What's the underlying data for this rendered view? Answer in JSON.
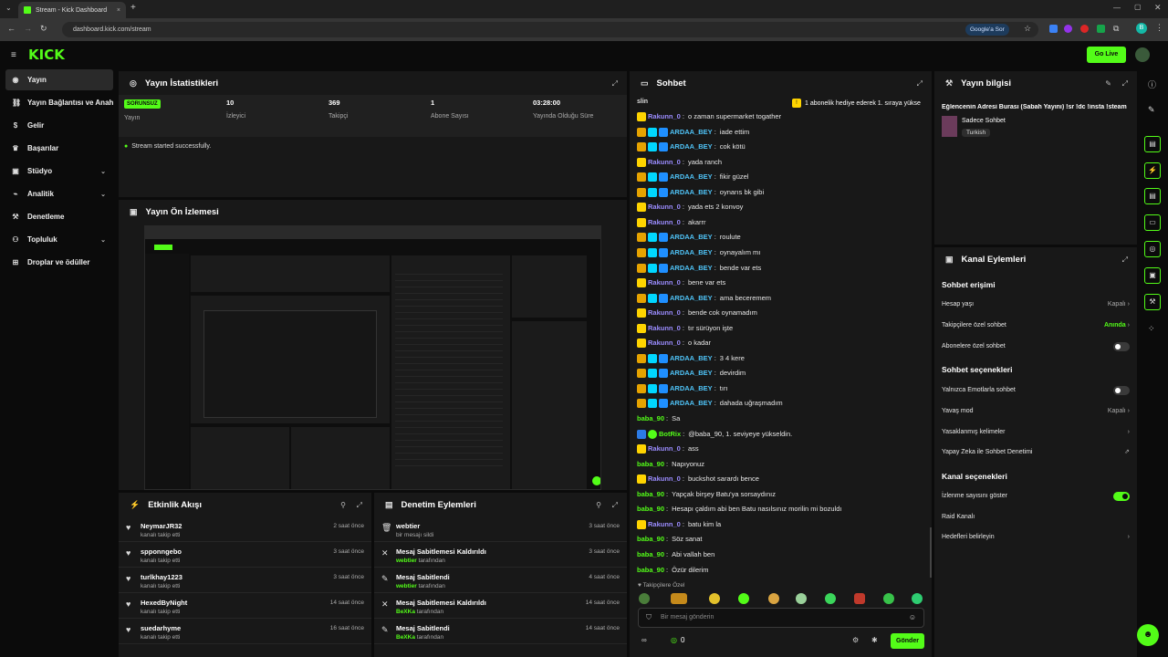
{
  "browser": {
    "tab_title": "Stream - Kick Dashboard",
    "url": "dashboard.kick.com/stream",
    "google_btn": "Google'a Sor"
  },
  "app": {
    "logo": "KICK",
    "go_live": "Go Live"
  },
  "sidebar": {
    "items": [
      {
        "label": "Yayın",
        "icon": "broadcast-icon"
      },
      {
        "label": "Yayın Bağlantısı ve Anahtar",
        "icon": "link-icon"
      },
      {
        "label": "Gelir",
        "icon": "money-icon"
      },
      {
        "label": "Başarılar",
        "icon": "trophy-icon"
      },
      {
        "label": "Stüdyo",
        "icon": "studio-icon"
      },
      {
        "label": "Analitik",
        "icon": "chart-icon"
      },
      {
        "label": "Denetleme",
        "icon": "wrench-icon"
      },
      {
        "label": "Topluluk",
        "icon": "community-icon"
      },
      {
        "label": "Droplar ve ödüller",
        "icon": "gift-icon"
      }
    ]
  },
  "stats": {
    "title": "Yayın İstatistikleri",
    "status_badge": "SORUNSUZ",
    "status_label": "Yayın",
    "viewers_value": "10",
    "viewers_label": "İzleyici",
    "followers_value": "369",
    "followers_label": "Takipçi",
    "subs_value": "1",
    "subs_label": "Abone Sayısı",
    "uptime_value": "03:28:00",
    "uptime_label": "Yayında Olduğu Süre",
    "message": "Stream started successfully."
  },
  "preview": {
    "title": "Yayın Ön İzlemesi"
  },
  "activity": {
    "title": "Etkinlik Akışı",
    "items": [
      {
        "user": "NeymarJR32",
        "action": "kanalı takip etti",
        "time": "2 saat önce"
      },
      {
        "user": "spponngebo",
        "action": "kanalı takip etti",
        "time": "3 saat önce"
      },
      {
        "user": "turlkhay1223",
        "action": "kanalı takip etti",
        "time": "3 saat önce"
      },
      {
        "user": "HexedByNight",
        "action": "kanalı takip etti",
        "time": "14 saat önce"
      },
      {
        "user": "suedarhyme",
        "action": "kanalı takip etti",
        "time": "16 saat önce"
      }
    ]
  },
  "moderation": {
    "title": "Denetim Eylemleri",
    "items": [
      {
        "title": "webtier",
        "by": "",
        "suffix": "bir mesajı sildi",
        "time": "3 saat önce"
      },
      {
        "title": "Mesaj Sabitlemesi Kaldırıldı",
        "by": "webtier",
        "suffix": "tarafından",
        "time": "3 saat önce"
      },
      {
        "title": "Mesaj Sabitlendi",
        "by": "webtier",
        "suffix": "tarafından",
        "time": "4 saat önce"
      },
      {
        "title": "Mesaj Sabitlemesi Kaldırıldı",
        "by": "BeXKa",
        "suffix": "tarafından",
        "time": "14 saat önce"
      },
      {
        "title": "Mesaj Sabitlendi",
        "by": "BeXKa",
        "suffix": "tarafından",
        "time": "14 saat önce"
      }
    ]
  },
  "chat": {
    "title": "Sohbet",
    "pinned_left": "slin",
    "pinned_banner": "1 abonelik hediye ederek 1. sıraya yükse",
    "messages": [
      {
        "user": "Rakunn_0",
        "cls": "rak",
        "badges": [
          "vip"
        ],
        "text": "o zaman supermarket togather"
      },
      {
        "user": "ARDAA_BEY",
        "cls": "ard",
        "badges": [
          "crown",
          "sub",
          "mod"
        ],
        "text": "iade ettim"
      },
      {
        "user": "ARDAA_BEY",
        "cls": "ard",
        "badges": [
          "crown",
          "sub",
          "mod"
        ],
        "text": "cok kötü"
      },
      {
        "user": "Rakunn_0",
        "cls": "rak",
        "badges": [
          "vip"
        ],
        "text": "yada ranch"
      },
      {
        "user": "ARDAA_BEY",
        "cls": "ard",
        "badges": [
          "crown",
          "sub",
          "mod"
        ],
        "text": "fikir güzel"
      },
      {
        "user": "ARDAA_BEY",
        "cls": "ard",
        "badges": [
          "crown",
          "sub",
          "mod"
        ],
        "text": "oynarıs bk gibi"
      },
      {
        "user": "Rakunn_0",
        "cls": "rak",
        "badges": [
          "vip"
        ],
        "text": "yada ets 2 konvoy"
      },
      {
        "user": "Rakunn_0",
        "cls": "rak",
        "badges": [
          "vip"
        ],
        "text": "akarrr"
      },
      {
        "user": "ARDAA_BEY",
        "cls": "ard",
        "badges": [
          "crown",
          "sub",
          "mod"
        ],
        "text": "roulute"
      },
      {
        "user": "ARDAA_BEY",
        "cls": "ard",
        "badges": [
          "crown",
          "sub",
          "mod"
        ],
        "text": "oynayalım mı"
      },
      {
        "user": "ARDAA_BEY",
        "cls": "ard",
        "badges": [
          "crown",
          "sub",
          "mod"
        ],
        "text": "bende var ets"
      },
      {
        "user": "Rakunn_0",
        "cls": "rak",
        "badges": [
          "vip"
        ],
        "text": "bene var ets"
      },
      {
        "user": "ARDAA_BEY",
        "cls": "ard",
        "badges": [
          "crown",
          "sub",
          "mod"
        ],
        "text": "ama beceremem"
      },
      {
        "user": "Rakunn_0",
        "cls": "rak",
        "badges": [
          "vip"
        ],
        "text": "bende cok oynamadım"
      },
      {
        "user": "Rakunn_0",
        "cls": "rak",
        "badges": [
          "vip"
        ],
        "text": "tır sürüyon işte"
      },
      {
        "user": "Rakunn_0",
        "cls": "rak",
        "badges": [
          "vip"
        ],
        "text": "o kadar"
      },
      {
        "user": "ARDAA_BEY",
        "cls": "ard",
        "badges": [
          "crown",
          "sub",
          "mod"
        ],
        "text": "3 4 kere"
      },
      {
        "user": "ARDAA_BEY",
        "cls": "ard",
        "badges": [
          "crown",
          "sub",
          "mod"
        ],
        "text": "devirdim"
      },
      {
        "user": "ARDAA_BEY",
        "cls": "ard",
        "badges": [
          "crown",
          "sub",
          "mod"
        ],
        "text": "tırı"
      },
      {
        "user": "ARDAA_BEY",
        "cls": "ard",
        "badges": [
          "crown",
          "sub",
          "mod"
        ],
        "text": "dahada uğraşmadım"
      },
      {
        "user": "baba_90",
        "cls": "bab",
        "badges": [],
        "text": "Sa"
      },
      {
        "user": "BotRix",
        "cls": "bot",
        "badges": [
          "bot",
          "ver"
        ],
        "text": "@baba_90, 1. seviyeye yükseldin."
      },
      {
        "user": "Rakunn_0",
        "cls": "rak",
        "badges": [
          "vip"
        ],
        "text": "ass"
      },
      {
        "user": "baba_90",
        "cls": "bab",
        "badges": [],
        "text": "Napıyonuz"
      },
      {
        "user": "Rakunn_0",
        "cls": "rak",
        "badges": [
          "vip"
        ],
        "text": "buckshot sarardı bence"
      },
      {
        "user": "baba_90",
        "cls": "bab",
        "badges": [],
        "text": "Yapçak birşey Batu'ya sorsaydınız"
      },
      {
        "user": "baba_90",
        "cls": "bab",
        "badges": [],
        "text": "Hesapı çaldım abi ben Batu nasılsınız morilin mi bozuldı"
      },
      {
        "user": "Rakunn_0",
        "cls": "rak",
        "badges": [
          "vip"
        ],
        "text": "batu kim la"
      },
      {
        "user": "baba_90",
        "cls": "bab",
        "badges": [],
        "text": "Söz sanat"
      },
      {
        "user": "baba_90",
        "cls": "bab",
        "badges": [],
        "text": "Abi vallah ben"
      },
      {
        "user": "baba_90",
        "cls": "bab",
        "badges": [],
        "text": "Özür dilerim"
      }
    ],
    "followers_only": "Takipçilere Özel",
    "input_placeholder": "Bir mesaj gönderin",
    "count": "0",
    "send": "Gönder"
  },
  "stream_info": {
    "title": "Yayın bilgisi",
    "stream_title": "Eğlencenin Adresi Burası (Sabah Yayını) !sr !dc !insta !steam",
    "category": "Sadece Sohbet",
    "tag": "Turkish"
  },
  "channel_actions": {
    "title": "Kanal Eylemleri",
    "sec_chat_access": "Sohbet erişimi",
    "account_age": "Hesap yaşı",
    "account_age_val": "Kapalı",
    "followers_chat": "Takipçilere özel sohbet",
    "followers_chat_val": "Anında",
    "subs_chat": "Abonelere özel sohbet",
    "sec_chat_options": "Sohbet seçenekleri",
    "emote_only": "Yalnızca Emotlarla sohbet",
    "slow_mode": "Yavaş mod",
    "slow_mode_val": "Kapalı",
    "banned_words": "Yasaklanmış kelimeler",
    "ai_moderation": "Yapay Zeka ile Sohbet Denetimi",
    "sec_channel_options": "Kanal seçenekleri",
    "show_viewers": "İzlenme sayısını göster",
    "raid": "Raid Kanalı",
    "targets": "Hedefleri belirleyin"
  },
  "colors": {
    "accent": "#53fc18",
    "panel": "#181818",
    "background": "#0b0b0b"
  }
}
